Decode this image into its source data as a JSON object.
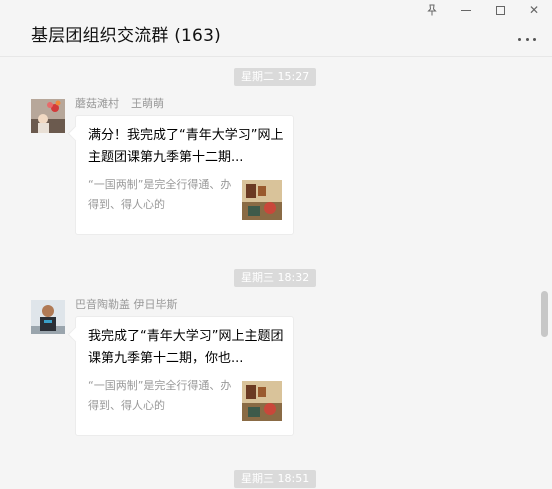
{
  "chat": {
    "title": "基层团组织交流群 (163)"
  },
  "window_controls": {
    "pin_icon": "pin-icon",
    "minimize_icon": "minimize-icon",
    "maximize_icon": "maximize-icon",
    "close_label": "✕",
    "more_icon": "more-dots-icon"
  },
  "messages": [
    {
      "time": "星期二 15:27",
      "sender_group_nick": "蘑菇滩村",
      "sender_name": "王萌萌",
      "card_title": "满分！我完成了“青年大学习”网上主题团课第九季第十二期...",
      "card_desc": "“一国两制”是完全行得通、办得到、得人心的"
    },
    {
      "time": "星期三 18:32",
      "sender_group_nick": "巴音陶勒盖 伊日毕斯",
      "sender_name": "",
      "card_title": "我完成了“青年大学习”网上主题团课第九季第十二期，你也...",
      "card_desc": "“一国两制”是完全行得通、办得到、得人心的"
    },
    {
      "time": "星期三 18:51"
    }
  ],
  "colors": {
    "background": "#f5f5f5",
    "time_pill": "#dadada",
    "card": "#ffffff",
    "sender_text": "#999999"
  }
}
